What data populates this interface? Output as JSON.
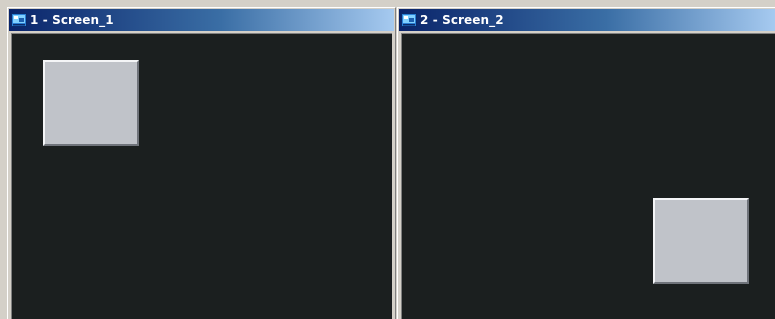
{
  "windows": [
    {
      "title": "1 - Screen_1",
      "icon": "screen-window-icon"
    },
    {
      "title": "2 - Screen_2",
      "icon": "screen-window-icon"
    }
  ],
  "colors": {
    "titlebar_start": "#0a246a",
    "titlebar_end": "#a6caf0",
    "canvas_background": "#1b1f1f",
    "block_fill": "#c0c3c9"
  }
}
